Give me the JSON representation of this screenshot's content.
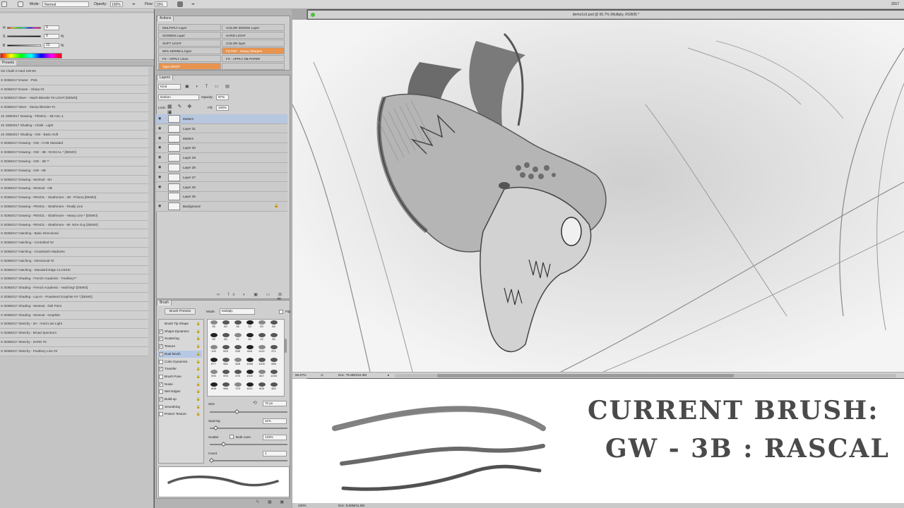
{
  "options_bar": {
    "mode_label": "Mode:",
    "mode_value": "Normal",
    "opacity_label": "Opacity:",
    "opacity_value": "100%",
    "flow_label": "Flow:",
    "flow_value": "33%",
    "right_text": "2017"
  },
  "color_panel": {
    "h_label": "H",
    "s_label": "S",
    "b_label": "B",
    "h_value": "0",
    "s_value": "0",
    "b_value": "22",
    "pct": "%"
  },
  "presets_panel": {
    "tab_label": "Presets",
    "items": [
      "SS Chalk 3 Hard 100-50",
      "S SDB2017 Eraser - Pink",
      "S SDB2017 Eraser - Sharp #2",
      "S SDB2017 Mixer - Hatch Blender #3 LIGHT [DEMO]",
      "S SDB2017 Mixer - Stump Blender #1",
      "JS SDB2017 Drawing - PENCIL - 4B AGL-1",
      "JS SDB2017 Shading - Chalk - Light",
      "JS SDB2017 Shading - GW - Basic Soft",
      "S SDB2017 Drawing - GW - 0 HB Standard",
      "S SDB2017 Drawing - GW - 3B - RASCAL * [DEMO]",
      "S SDB2017 Drawing - GW - 4B **",
      "S SDB2017 Drawing - GW - 6B",
      "S SDB2017 Drawing - Montval - 6H",
      "S SDB2017 Drawing - Montval - HB",
      "S SDB2017 Drawing - PENCIL - Strathmore - 2B - Prisma [DEMO]",
      "S SDB2017 Drawing - PENCIL - Strathmore - Really Line",
      "S SDB2017 Drawing - PENCIL - Strathmore - Heavy Line * [DEMO]",
      "S SDB2017 Drawing - PENCIL - Strathmore - Mr. Nice Guy [DEMO]",
      "S SDB2017 Hatching - Basic Directional",
      "S SDB2017 Hatching - Controlled #2",
      "S SDB2017 Hatching - Crosshatch Madness",
      "S SDB2017 Hatching - Directional #2",
      "S SDB2017 Hatching - Standard Edge CLASSIC",
      "S SDB2017 Shading - French Academic - Feathery**",
      "S SDB2017 Shading - French Academic - Hatching* [DEMO]",
      "S SDB2017 Shading - Lay-In - Powdered Graphite #3 * [DEMO]",
      "S SDB2017 Shading - Montval - Dull Point",
      "S SDB2017 Shading - Montval - Graphite",
      "S SDB2017 Sketchy - 2H - Amid Line Light",
      "S SDB2017 Sketchy - Broad Spectrum",
      "S SDB2017 Sketchy - DARK #3",
      "S SDB2017 Sketchy - Feathery Line #2"
    ]
  },
  "actions_panel": {
    "tab_label": "Actions",
    "buttons": [
      {
        "label": "MULTIPLY Layer",
        "orange": false
      },
      {
        "label": "COLOR DODGE Layer",
        "orange": false
      },
      {
        "label": "SCREEN Layer",
        "orange": false
      },
      {
        "label": "HARD LIGHT",
        "orange": false
      },
      {
        "label": "SOFT LIGHT",
        "orange": false
      },
      {
        "label": "COLOR layer",
        "orange": false
      },
      {
        "label": "50% NORMAL layer",
        "orange": false
      },
      {
        "label": "FILTER - Heavy Sharpen",
        "orange": true
      },
      {
        "label": "FX - APPLY Linen",
        "orange": false
      },
      {
        "label": "FX - APPLY DB PAPER",
        "orange": false
      },
      {
        "label": "Type DROP",
        "orange": true
      },
      {
        "label": "",
        "orange": false
      }
    ]
  },
  "layers_panel": {
    "tab_label": "Layers",
    "kind_label": "Kind",
    "blend_value": "Darken",
    "opacity_label": "Opacity:",
    "opacity_value": "97%",
    "lock_label": "Lock:",
    "fill_label": "Fill:",
    "fill_value": "100%",
    "layers": [
      {
        "name": "Mutiers",
        "selected": true,
        "visible": true
      },
      {
        "name": "Layer 31",
        "selected": false,
        "visible": true
      },
      {
        "name": "Mutiers",
        "selected": false,
        "visible": true
      },
      {
        "name": "Layer 30",
        "selected": false,
        "visible": true
      },
      {
        "name": "Layer 29",
        "selected": false,
        "visible": true
      },
      {
        "name": "Layer 28",
        "selected": false,
        "visible": true
      },
      {
        "name": "Layer 27",
        "selected": false,
        "visible": true
      },
      {
        "name": "Layer 26",
        "selected": false,
        "visible": true
      },
      {
        "name": "Layer 25",
        "selected": false,
        "visible": false
      },
      {
        "name": "Background",
        "selected": false,
        "visible": true
      }
    ]
  },
  "brush_panel": {
    "tab_label": "Brush",
    "presets_button": "Brush Presets",
    "mode_label": "Mode:",
    "mode_value": "Multiply",
    "flip_label": "Flip",
    "options": [
      {
        "label": "Brush Tip Shape",
        "checked": null,
        "selected": false
      },
      {
        "label": "Shape Dynamics",
        "checked": true,
        "selected": false
      },
      {
        "label": "Scattering",
        "checked": true,
        "selected": false
      },
      {
        "label": "Texture",
        "checked": true,
        "selected": false
      },
      {
        "label": "Dual Brush",
        "checked": true,
        "selected": true
      },
      {
        "label": "Color Dynamics",
        "checked": false,
        "selected": false
      },
      {
        "label": "Transfer",
        "checked": true,
        "selected": false
      },
      {
        "label": "Brush Pose",
        "checked": false,
        "selected": false
      },
      {
        "label": "Noise",
        "checked": true,
        "selected": false
      },
      {
        "label": "Wet Edges",
        "checked": false,
        "selected": false
      },
      {
        "label": "Build-up",
        "checked": true,
        "selected": false
      },
      {
        "label": "Smoothing",
        "checked": false,
        "selected": false
      },
      {
        "label": "Protect Texture",
        "checked": false,
        "selected": false
      }
    ],
    "tips": [
      "35",
      "80",
      "36",
      "33",
      "63",
      "66",
      "39",
      "63",
      "11",
      "48",
      "22",
      "55",
      "100",
      "549",
      "258",
      "848",
      "1112",
      "371",
      "877",
      "982",
      "458",
      "1068",
      "1105",
      "985",
      "590",
      "993",
      "376",
      "1300",
      "667",
      "1263",
      "898",
      "966",
      "723",
      "1611",
      "806",
      "362"
    ],
    "size_label": "Size",
    "size_value": "70 px",
    "spacing_label": "Spacing",
    "spacing_value": "11%",
    "scatter_label": "Scatter",
    "both_axes_label": "Both Axes",
    "scatter_value": "133%",
    "count_label": "Count",
    "count_value": "1",
    "size_pct": 0.33,
    "spacing_pct": 0.05,
    "scatter_pct": 0.15,
    "count_pct": 0.0
  },
  "document": {
    "title": "demo1x3.psd @ 66.7% (Multiply, RGB/8) *",
    "zoom": "66.67%",
    "doc_info": "Doc: 75.8M/424.0M",
    "bottom_zoom": "100%",
    "bottom_doc_info": "Doc: 8.59M/11.0M"
  },
  "overlay": {
    "line1": "CURRENT BRUSH:",
    "line2": "GW - 3B : RASCAL"
  },
  "tools": [
    "tool-history-icon",
    "tool-info-icon",
    "tool-character-icon",
    "tool-paragraph-icon"
  ]
}
